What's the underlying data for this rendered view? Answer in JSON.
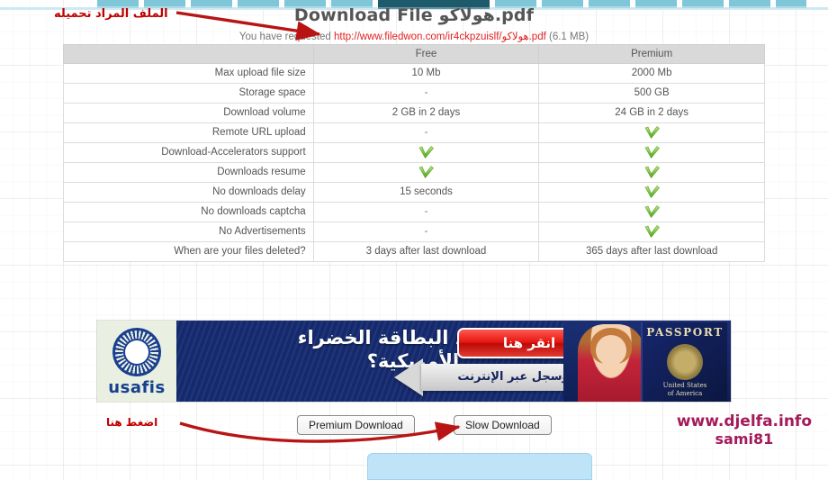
{
  "header": {
    "title": "Download File هولاكو.pdf",
    "requested_prefix": "You have requested",
    "url": "http://www.filedwon.com/ir4ckpzuislf/هولاكو.pdf",
    "size": "(6.1 MB)"
  },
  "table": {
    "columns": [
      "",
      "Free",
      "Premium"
    ],
    "rows": [
      {
        "feature": "Max upload file size",
        "free": "10 Mb",
        "premium": "2000 Mb"
      },
      {
        "feature": "Storage space",
        "free": "-",
        "premium": "500 GB"
      },
      {
        "feature": "Download volume",
        "free": "2 GB in 2 days",
        "premium": "24 GB in 2 days"
      },
      {
        "feature": "Remote URL upload",
        "free": "-",
        "premium": "check"
      },
      {
        "feature": "Download-Accelerators support",
        "free": "check",
        "premium": "check"
      },
      {
        "feature": "Downloads resume",
        "free": "check",
        "premium": "check"
      },
      {
        "feature": "No downloads delay",
        "free": "15 seconds",
        "premium": "check"
      },
      {
        "feature": "No downloads captcha",
        "free": "-",
        "premium": "check"
      },
      {
        "feature": "No Advertisements",
        "free": "-",
        "premium": "check"
      },
      {
        "feature": "When are your files deleted?",
        "free": "3 days after last download",
        "premium": "365 days after last download"
      }
    ]
  },
  "ad": {
    "logo_text": "usafis",
    "headline_line1": "هل  تريد البطاقة الخضراء",
    "headline_line2": "الأمريكية؟",
    "cta_label": "انقر هنا",
    "arrow_label": "وسجل عبر الإنترنت",
    "passport_word": "PASSPORT",
    "passport_country_line1": "United States",
    "passport_country_line2": "of America"
  },
  "buttons": {
    "premium_download": "Premium Download",
    "slow_download": "Slow Download"
  },
  "annotations": {
    "top": "الملف المراد تحميله",
    "bottom": "اضغط هنا"
  },
  "watermark": {
    "line1": "www.djelfa.info",
    "line2": "sami81"
  },
  "colors": {
    "annotation_red": "#c00000",
    "url_red": "#e02020",
    "check_green": "#7dc242",
    "ad_blue": "#152a6e",
    "watermark": "#a41a5a",
    "tab_teal": "#7fc6d8",
    "tab_active": "#1d5a6b"
  }
}
